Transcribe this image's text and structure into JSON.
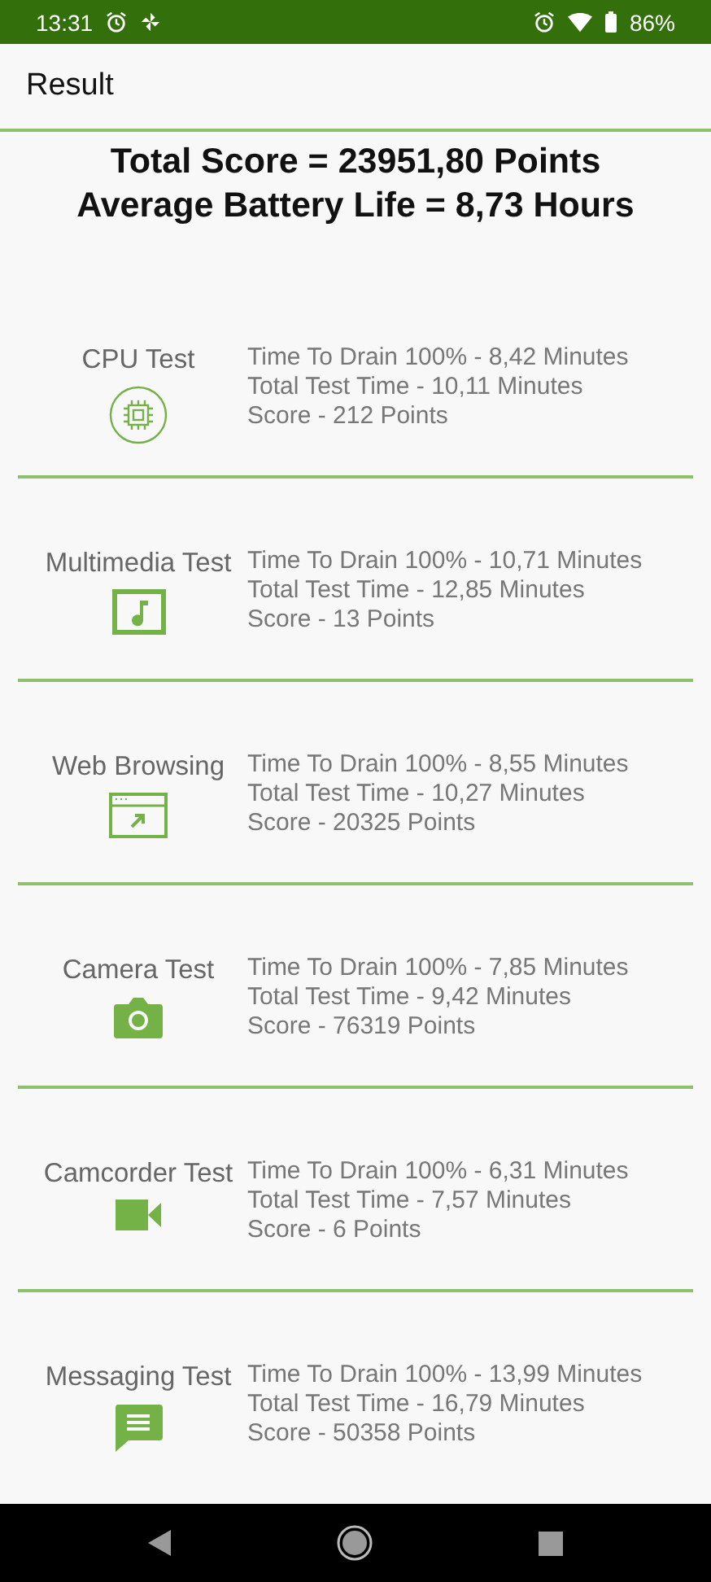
{
  "status_bar": {
    "time": "13:31",
    "battery": "86%"
  },
  "app_bar": {
    "title": "Result"
  },
  "summary": [
    "Total Score = 23951,80 Points",
    "Average Battery Life = 8,73 Hours"
  ],
  "tests": [
    {
      "name": "CPU Test",
      "kind": "cpu",
      "lines": [
        "Time To Drain 100% - 8,42 Minutes",
        "Total Test Time - 10,11 Minutes",
        "Score - 212 Points"
      ]
    },
    {
      "name": "Multimedia Test",
      "kind": "media",
      "lines": [
        "Time To Drain 100% - 10,71 Minutes",
        "Total Test Time - 12,85 Minutes",
        "Score - 13 Points"
      ]
    },
    {
      "name": "Web Browsing",
      "kind": "web",
      "lines": [
        "Time To Drain 100% - 8,55 Minutes",
        "Total Test Time - 10,27 Minutes",
        "Score - 20325 Points"
      ]
    },
    {
      "name": "Camera Test",
      "kind": "camera",
      "lines": [
        "Time To Drain 100% - 7,85 Minutes",
        "Total Test Time - 9,42 Minutes",
        "Score - 76319 Points"
      ]
    },
    {
      "name": "Camcorder Test",
      "kind": "camcorder",
      "lines": [
        "Time To Drain 100% - 6,31 Minutes",
        "Total Test Time - 7,57 Minutes",
        "Score - 6 Points"
      ]
    },
    {
      "name": "Messaging Test",
      "kind": "message",
      "lines": [
        "Time To Drain 100% - 13,99 Minutes",
        "Total Test Time - 16,79 Minutes",
        "Score - 50358 Points"
      ]
    }
  ]
}
